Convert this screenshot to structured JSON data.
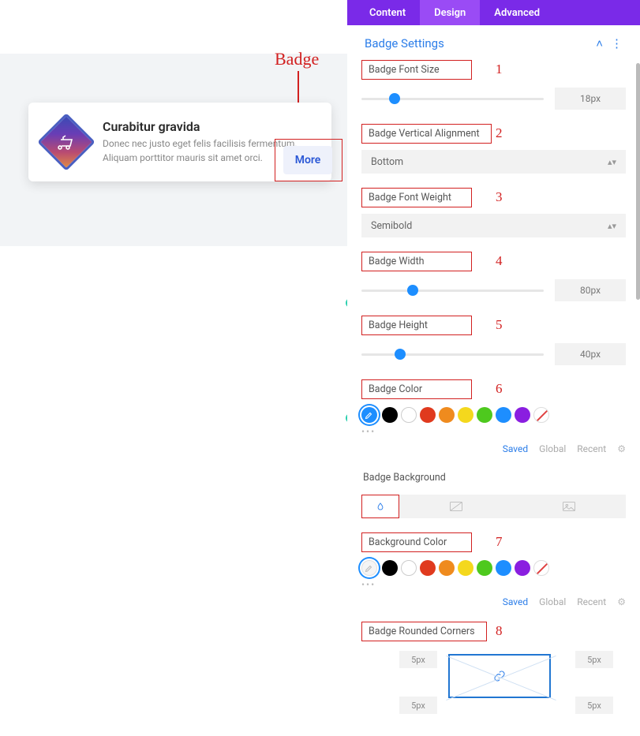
{
  "annotation": {
    "label": "Badge"
  },
  "card": {
    "title": "Curabitur gravida",
    "description": "Donec nec justo eget felis facilisis fermentum. Aliquam porttitor mauris sit amet orci.",
    "badge_text": "More"
  },
  "panel": {
    "tabs": {
      "content": "Content",
      "design": "Design",
      "advanced": "Advanced",
      "active": "design"
    },
    "section_title": "Badge Settings",
    "controls": {
      "font_size": {
        "label": "Badge Font Size",
        "num": "1",
        "value": "18px",
        "thumb_pct": 15
      },
      "valign": {
        "label": "Badge Vertical Alignment",
        "num": "2",
        "value": "Bottom"
      },
      "font_weight": {
        "label": "Badge Font Weight",
        "num": "3",
        "value": "Semibold"
      },
      "width": {
        "label": "Badge Width",
        "num": "4",
        "value": "80px",
        "thumb_pct": 25
      },
      "height": {
        "label": "Badge Height",
        "num": "5",
        "value": "40px",
        "thumb_pct": 18
      },
      "color": {
        "label": "Badge Color",
        "num": "6"
      },
      "bg_header": {
        "label": "Badge Background"
      },
      "bg_color": {
        "label": "Background Color",
        "num": "7"
      },
      "corners": {
        "label": "Badge Rounded Corners",
        "num": "8",
        "tl": "5px",
        "tr": "5px",
        "bl": "5px",
        "br": "5px"
      }
    },
    "palette": [
      "#000000",
      "#ffffff",
      "#e03a1e",
      "#ef8b1e",
      "#f4d81d",
      "#4ec91e",
      "#1d8eff",
      "#8a1ee0"
    ],
    "saved_row": {
      "saved": "Saved",
      "global": "Global",
      "recent": "Recent"
    }
  }
}
